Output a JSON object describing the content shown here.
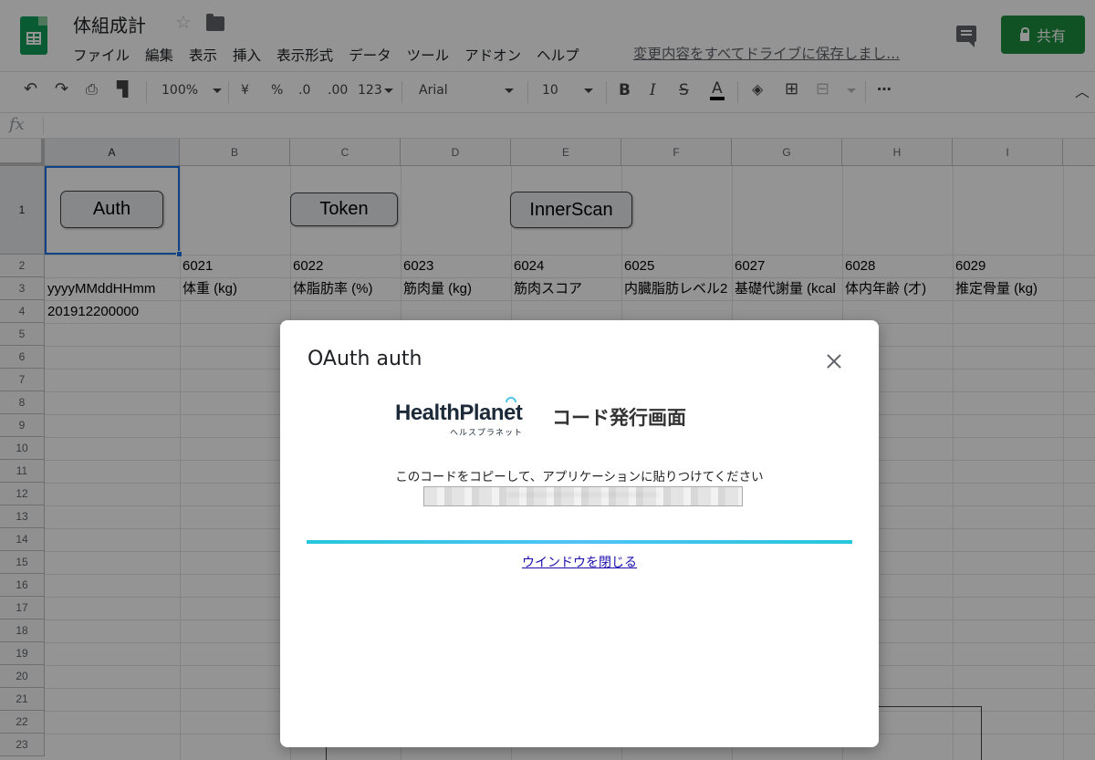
{
  "header": {
    "doc_title": "体組成計",
    "menu": [
      "ファイル",
      "編集",
      "表示",
      "挿入",
      "表示形式",
      "データ",
      "ツール",
      "アドオン",
      "ヘルプ"
    ],
    "save_status": "変更内容をすべてドライブに保存しまし...",
    "share_label": "共有"
  },
  "toolbar": {
    "zoom": "100%",
    "currency": "¥",
    "percent": "%",
    "decimal_less": ".0",
    "decimal_more": ".00",
    "format_more": "123",
    "font": "Arial",
    "font_size": "10",
    "bold": "B",
    "italic": "I",
    "strike": "S",
    "text_color": "A"
  },
  "formula_bar": {
    "fx": "fx",
    "value": ""
  },
  "sheet": {
    "columns": [
      "A",
      "B",
      "C",
      "D",
      "E",
      "F",
      "G",
      "H",
      "I"
    ],
    "rows": [
      "1",
      "2",
      "3",
      "4",
      "5",
      "6",
      "7",
      "8",
      "9",
      "10",
      "11",
      "12",
      "13",
      "14",
      "15",
      "16",
      "17",
      "18",
      "19",
      "20",
      "21",
      "22",
      "23"
    ],
    "buttons": {
      "auth": "Auth",
      "token": "Token",
      "innerscan": "InnerScan"
    },
    "row2": [
      "",
      "6021",
      "6022",
      "6023",
      "6024",
      "6025",
      "6027",
      "6028",
      "6029"
    ],
    "row3": [
      "yyyyMMddHHmm",
      "体重 (kg)",
      "体脂肪率 (%)",
      "筋肉量 (kg)",
      "筋肉スコア",
      "内臓脂肪レベル2",
      "基礎代謝量 (kcal",
      "体内年齢 (才)",
      "推定骨量 (kg)"
    ],
    "row4": [
      "201912200000"
    ]
  },
  "dialog": {
    "title": "OAuth auth",
    "logo_text": "HealthPlanet",
    "logo_subtext": "ヘルスプラネット",
    "heading": "コード発行画面",
    "instruction": "このコードをコピーして、アプリケーションに貼りつけてください",
    "close_link": "ウインドウを閉じる"
  },
  "colors": {
    "share_green": "#1e8e3e",
    "selection_blue": "#1a73e8",
    "progress_cyan": "#26c6da",
    "link_blue": "#1a0dab"
  }
}
